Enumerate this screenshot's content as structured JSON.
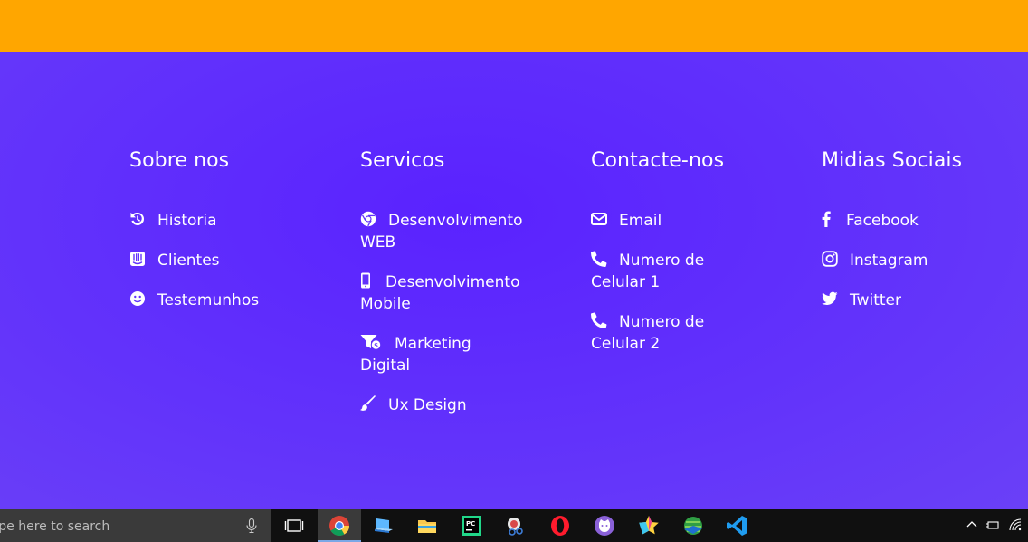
{
  "columns": [
    {
      "title": "Sobre nos",
      "items": [
        {
          "label": "Historia",
          "icon": "history-icon"
        },
        {
          "label": "Clientes",
          "icon": "intercom-icon"
        },
        {
          "label": "Testemunhos",
          "icon": "smile-icon"
        }
      ]
    },
    {
      "title": "Servicos",
      "items": [
        {
          "label": "Desenvolvimento WEB",
          "icon": "chrome-icon"
        },
        {
          "label": "Desenvolvimento Mobile",
          "icon": "mobile-icon"
        },
        {
          "label": "Marketing Digital",
          "icon": "funnel-dollar-icon"
        },
        {
          "label": "Ux Design",
          "icon": "paint-brush-icon"
        }
      ]
    },
    {
      "title": "Contacte-nos",
      "items": [
        {
          "label": "Email",
          "icon": "envelope-icon"
        },
        {
          "label": "Numero de Celular 1",
          "icon": "phone-icon"
        },
        {
          "label": "Numero de Celular 2",
          "icon": "phone-icon"
        }
      ]
    },
    {
      "title": "Midias Sociais",
      "items": [
        {
          "label": "Facebook",
          "icon": "facebook-icon"
        },
        {
          "label": "Instagram",
          "icon": "instagram-icon"
        },
        {
          "label": "Twitter",
          "icon": "twitter-icon"
        }
      ]
    }
  ],
  "taskbar": {
    "search_placeholder": "ype here to search"
  },
  "colors": {
    "topbar": "#ffa600",
    "footer": "#5b2bff",
    "taskbar": "#101010"
  }
}
